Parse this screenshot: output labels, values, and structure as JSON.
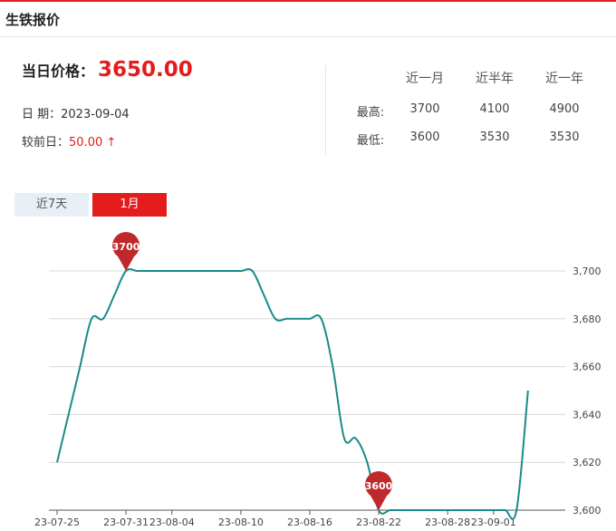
{
  "header": {
    "title": "生铁报价"
  },
  "summary": {
    "price_label": "当日价格：",
    "price": "3650.00",
    "date_label": "日 期：",
    "date": "2023-09-04",
    "change_label": "较前日：",
    "change": "50.00",
    "change_arrow": "↑"
  },
  "stats": {
    "headers": [
      "近一月",
      "近半年",
      "近一年"
    ],
    "rows": [
      {
        "label": "最高:",
        "values": [
          "3700",
          "4100",
          "4900"
        ]
      },
      {
        "label": "最低:",
        "values": [
          "3600",
          "3530",
          "3530"
        ]
      }
    ]
  },
  "tabs": [
    {
      "label": "近7天",
      "active": false
    },
    {
      "label": "1月",
      "active": true
    }
  ],
  "colors": {
    "accent": "#e41c1c",
    "line": "#1a8a8a",
    "pin": "#c0292b"
  },
  "chart_data": {
    "type": "line",
    "x": [
      "23-07-25",
      "23-07-26",
      "23-07-27",
      "23-07-28",
      "23-07-29",
      "23-07-30",
      "23-07-31",
      "23-08-01",
      "23-08-02",
      "23-08-03",
      "23-08-04",
      "23-08-05",
      "23-08-06",
      "23-08-07",
      "23-08-08",
      "23-08-09",
      "23-08-10",
      "23-08-11",
      "23-08-12",
      "23-08-13",
      "23-08-14",
      "23-08-15",
      "23-08-16",
      "23-08-17",
      "23-08-18",
      "23-08-19",
      "23-08-20",
      "23-08-21",
      "23-08-22",
      "23-08-23",
      "23-08-24",
      "23-08-25",
      "23-08-26",
      "23-08-27",
      "23-08-28",
      "23-08-29",
      "23-08-30",
      "23-08-31",
      "23-09-01",
      "23-09-02",
      "23-09-03",
      "23-09-04"
    ],
    "series": [
      {
        "values": [
          3620,
          3640,
          3660,
          3680,
          3680,
          3690,
          3700,
          3700,
          3700,
          3700,
          3700,
          3700,
          3700,
          3700,
          3700,
          3700,
          3700,
          3700,
          3690,
          3680,
          3680,
          3680,
          3680,
          3680,
          3660,
          3630,
          3630,
          3620,
          3600,
          3600,
          3600,
          3600,
          3600,
          3600,
          3600,
          3600,
          3600,
          3600,
          3600,
          3600,
          3600,
          3650
        ]
      }
    ],
    "x_tick_labels": [
      "23-07-25",
      "23-07-31",
      "23-08-04",
      "23-08-10",
      "23-08-16",
      "23-08-22",
      "23-08-28",
      "23-09-01"
    ],
    "y_tick_labels": [
      "3,600",
      "3,620",
      "3,640",
      "3,660",
      "3,680",
      "3,700"
    ],
    "ylim": [
      3600,
      3700
    ],
    "grid": true,
    "markers": [
      {
        "label": "3700",
        "x": "23-07-31",
        "y": 3700
      },
      {
        "label": "3600",
        "x": "23-08-22",
        "y": 3600
      }
    ],
    "title": "",
    "xlabel": "",
    "ylabel": ""
  }
}
